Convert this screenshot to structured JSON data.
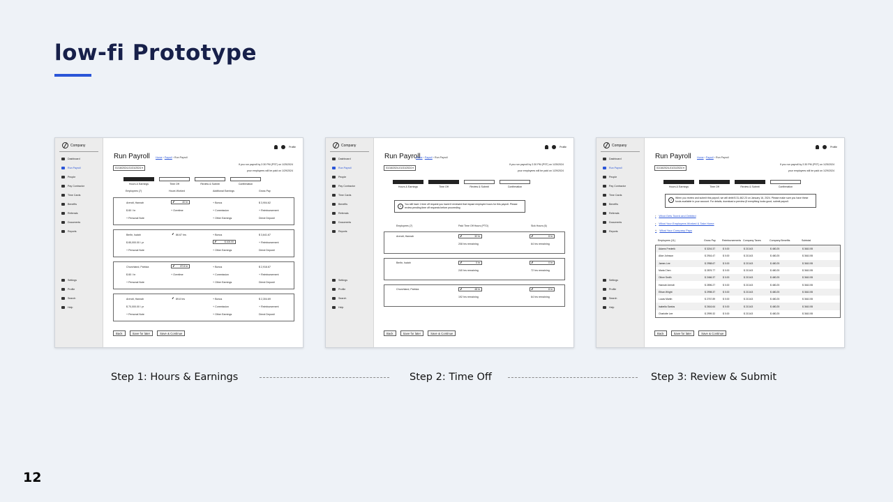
{
  "slide": {
    "title": "low-fi Prototype",
    "page_number": "12"
  },
  "app": {
    "company": "Company",
    "nav_top": [
      "Dashboard",
      "Run Payroll",
      "People",
      "Pay Contractor",
      "Time Cards",
      "Benefits",
      "Referrals",
      "Documents",
      "Reports"
    ],
    "nav_bottom": [
      "Settings",
      "Profile",
      "Search",
      "Help"
    ],
    "profile": "Profile",
    "page_title": "Run Payroll",
    "breadcrumb": {
      "home": "Home",
      "payroll": "Payroll",
      "current": "Run Payroll"
    },
    "date_range": "01/16/2024-01/31/2024",
    "notice_line1": "If you run payroll by 2:30 PM (PST) on 1/25/2024",
    "notice_line2": "your employees will be paid on 1/29/2024",
    "steps": [
      "Hours & Earnings",
      "Time Off",
      "Review & Submit",
      "Confirmation"
    ],
    "buttons": {
      "back": "Back",
      "save_later": "Save for later",
      "save_continue": "Save & Continue"
    }
  },
  "step1": {
    "headers": [
      "Employees (7)",
      "Hours Worked",
      "Additional Earnings",
      "Gross Pay"
    ],
    "employees": [
      {
        "name": "Arendt, Hannah",
        "rate": "$ 80 / hr",
        "note": "+ Personal Note",
        "hours": "40 hr",
        "extra": "+ Overtime",
        "earn": [
          "+ Bonus",
          "+ Commission",
          "+ Other Earnings"
        ],
        "gross": "$ 3,904.62",
        "reimb": "+ Reimbursement",
        "deposit": "Direct Deposit"
      },
      {
        "name": "Berlin, Isaiah",
        "rate": "$ 85,000.00 / yr",
        "note": "+ Personal Note",
        "hours": "86.67 hrs",
        "extra": "",
        "earn": [
          "+ Bonus",
          "$ 100.00",
          "+ Other Earnings"
        ],
        "gross": "$ 3,641.67",
        "reimb": "+ Reimbursement",
        "deposit": "Direct Deposit"
      },
      {
        "name": "Churchland, Patricia",
        "rate": "$ 80 / hr",
        "note": "+ Personal Note",
        "hours": "87.8 hr",
        "extra": "+ Overtime",
        "earn": [
          "+ Bonus",
          "+ Commission",
          "+ Other Earnings"
        ],
        "gross": "$ 2,916.67",
        "reimb": "+ Reimbursement",
        "deposit": "Direct Deposit"
      },
      {
        "name": "Arendt, Hannah",
        "rate": "$ 70,000.00 / yr",
        "note": "+ Personal Note",
        "hours": "89.8 hrs",
        "extra": "",
        "earn": [
          "+ Bonus",
          "+ Commission",
          "+ Other Earnings"
        ],
        "gross": "$ 2,304.69",
        "reimb": "+ Reimbursement",
        "deposit": "Direct Deposit"
      }
    ]
  },
  "step2": {
    "alert": "You still have 1 time off request you haven't reviewed that impact employee hours for this payroll. Please review pending time off requests before proceeding",
    "headers": [
      "Employees (7)",
      "Paid Time Off Hours (PTO)",
      "Sick Hours (6)"
    ],
    "employees": [
      {
        "name": "Arendt, Hannah",
        "pto": "32 hr",
        "pto_rem": "208 hrs remaining",
        "sick": "8 hr",
        "sick_rem": "64 hrs remaining"
      },
      {
        "name": "Berlin, Isaiah",
        "pto": "0 hr",
        "pto_rem": "240 hrs remaining",
        "sick": "0 hr",
        "sick_rem": "72 hrs remaining"
      },
      {
        "name": "Churchland, Patricia",
        "pto": "48 hr",
        "pto_rem": "192 hrs remaining",
        "sick": "8 hr",
        "sick_rem": "64 hrs remaining"
      }
    ]
  },
  "step3": {
    "alert": "When you review and submit this payroll, we will debit $ 31,462.23 on January 16, 2024. Please make sure you have these funds available in your account. For details, download a preview (if everything looks good, submit payroll.",
    "links": [
      "What Gets Taxed and Debited",
      "What Your Employees Worked & Take Home",
      "What Your Company Pays"
    ],
    "headers": [
      "Employees (11)",
      "Gross Pay",
      "Reimbursements",
      "Company Taxes",
      "Company Benefits",
      "Subtotal"
    ],
    "rows": [
      [
        "Adams Frederik",
        "$ 3216.37",
        "$ 0.00",
        "$ 213.63",
        "$ 480.25",
        "$ 3610.55"
      ],
      [
        "Alice Johnson",
        "$ 2916.47",
        "$ 0.00",
        "$ 213.63",
        "$ 480.25",
        "$ 3610.55"
      ],
      [
        "James Lee",
        "$ 2958.67",
        "$ 0.00",
        "$ 213.63",
        "$ 480.25",
        "$ 3610.55"
      ],
      [
        "Maria Chen",
        "$ 2876.77",
        "$ 0.00",
        "$ 213.63",
        "$ 480.25",
        "$ 3610.55"
      ],
      [
        "Oliver Smith",
        "$ 2466.37",
        "$ 0.00",
        "$ 213.63",
        "$ 480.25",
        "$ 3610.55"
      ],
      [
        "Hannah Arendt",
        "$ 2896.27",
        "$ 0.00",
        "$ 213.63",
        "$ 480.25",
        "$ 3610.55"
      ],
      [
        "Ethan Wright",
        "$ 2998.37",
        "$ 0.00",
        "$ 213.63",
        "$ 480.25",
        "$ 3610.55"
      ],
      [
        "Lucas Martin",
        "$ 2767.89",
        "$ 0.00",
        "$ 213.63",
        "$ 480.25",
        "$ 3610.55"
      ],
      [
        "Isabella Santos",
        "$ 2616.64",
        "$ 0.00",
        "$ 213.63",
        "$ 480.25",
        "$ 3610.55"
      ],
      [
        "Charlotte Lee",
        "$ 2999.32",
        "$ 0.00",
        "$ 213.63",
        "$ 480.25",
        "$ 3610.55"
      ]
    ]
  },
  "captions": [
    "Step 1: Hours & Earnings",
    "Step 2: Time Off",
    "Step 3: Review & Submit"
  ],
  "colors": {
    "accent": "#2a55d8",
    "title": "#17204a",
    "background": "#eef2f7"
  }
}
